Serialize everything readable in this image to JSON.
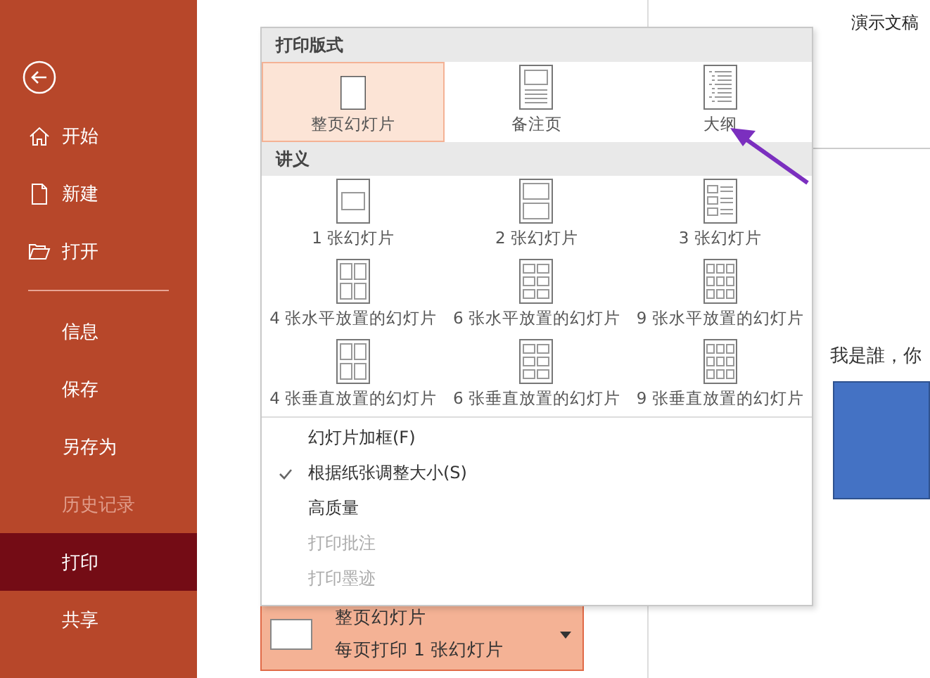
{
  "sidebar": {
    "items": [
      {
        "label": "开始",
        "selected": false,
        "disabled": false
      },
      {
        "label": "新建",
        "selected": false,
        "disabled": false
      },
      {
        "label": "打开",
        "selected": false,
        "disabled": false
      },
      {
        "label": "信息",
        "selected": false,
        "disabled": false
      },
      {
        "label": "保存",
        "selected": false,
        "disabled": false
      },
      {
        "label": "另存为",
        "selected": false,
        "disabled": false
      },
      {
        "label": "历史记录",
        "selected": false,
        "disabled": true
      },
      {
        "label": "打印",
        "selected": true,
        "disabled": false
      },
      {
        "label": "共享",
        "selected": false,
        "disabled": false
      }
    ]
  },
  "layout_menu": {
    "sections": [
      {
        "title": "打印版式",
        "items": [
          {
            "label": "整页幻灯片",
            "selected": true
          },
          {
            "label": "备注页",
            "selected": false
          },
          {
            "label": "大纲",
            "selected": false
          }
        ]
      },
      {
        "title": "讲义",
        "items": [
          {
            "label": "1 张幻灯片",
            "selected": false
          },
          {
            "label": "2 张幻灯片",
            "selected": false
          },
          {
            "label": "3 张幻灯片",
            "selected": false
          },
          {
            "label": "4 张水平放置的幻灯片",
            "selected": false
          },
          {
            "label": "6 张水平放置的幻灯片",
            "selected": false
          },
          {
            "label": "9 张水平放置的幻灯片",
            "selected": false
          },
          {
            "label": "4 张垂直放置的幻灯片",
            "selected": false
          },
          {
            "label": "6 张垂直放置的幻灯片",
            "selected": false
          },
          {
            "label": "9 张垂直放置的幻灯片",
            "selected": false
          }
        ]
      }
    ],
    "options": [
      {
        "label": "幻灯片加框(F)",
        "checked": false,
        "disabled": false
      },
      {
        "label": "根据纸张调整大小(S)",
        "checked": true,
        "disabled": false
      },
      {
        "label": "高质量",
        "checked": false,
        "disabled": false
      },
      {
        "label": "打印批注",
        "checked": false,
        "disabled": true
      },
      {
        "label": "打印墨迹",
        "checked": false,
        "disabled": true
      }
    ]
  },
  "layout_button": {
    "title": "整页幻灯片",
    "subtitle": "每页打印 1 张幻灯片"
  },
  "preview": {
    "document_title": "演示文稿",
    "slide_text": "我是誰，你"
  }
}
